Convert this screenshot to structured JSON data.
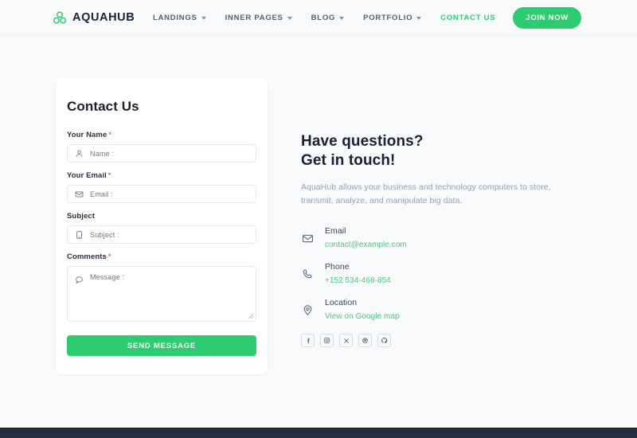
{
  "header": {
    "brand": {
      "name": "AQUAHUB",
      "icon": "three-circles-logo-icon"
    },
    "nav": [
      {
        "label": "LANDINGS",
        "has_caret": true,
        "active": false
      },
      {
        "label": "INNER PAGES",
        "has_caret": true,
        "active": false
      },
      {
        "label": "BLOG",
        "has_caret": true,
        "active": false
      },
      {
        "label": "PORTFOLIO",
        "has_caret": true,
        "active": false
      },
      {
        "label": "CONTACT US",
        "has_caret": false,
        "active": true
      }
    ],
    "cta": {
      "label": "JOIN NOW"
    }
  },
  "form": {
    "title": "Contact Us",
    "fields": [
      {
        "label": "Your Name",
        "required": true,
        "placeholder": "Name :",
        "icon": "user-icon"
      },
      {
        "label": "Your Email",
        "required": true,
        "placeholder": "Email :",
        "icon": "envelope-icon"
      },
      {
        "label": "Subject",
        "required": false,
        "placeholder": "Subject :",
        "icon": "note-icon"
      },
      {
        "label": "Comments",
        "required": true,
        "placeholder": "Message :",
        "icon": "chat-bubble-icon"
      }
    ],
    "required_marker": "*",
    "submit_label": "SEND MESSAGE"
  },
  "right": {
    "heading_line1": "Have questions?",
    "heading_line2": "Get in touch!",
    "description": "AquaHub allows your business and technology computers to store, transmit, analyze, and manipulate big data.",
    "contacts": [
      {
        "icon": "envelope-icon",
        "label": "Email",
        "value": "contact@example.com"
      },
      {
        "icon": "phone-icon",
        "label": "Phone",
        "value": "+152 534-468-854"
      },
      {
        "icon": "location-pin-icon",
        "label": "Location",
        "value": "View on Google map"
      }
    ],
    "socials": [
      {
        "name": "facebook-icon",
        "glyph": "f"
      },
      {
        "name": "instagram-icon",
        "glyph": ""
      },
      {
        "name": "x-twitter-icon",
        "glyph": "X"
      },
      {
        "name": "dribbble-icon",
        "glyph": ""
      },
      {
        "name": "github-icon",
        "glyph": ""
      }
    ]
  },
  "colors": {
    "accent_green": "#2ecc71",
    "link_green": "#4dc97e",
    "required_red": "#ff5a5f",
    "dark_navy": "#262b42",
    "page_bg": "#f8f9fb",
    "text_dark": "#1d2033",
    "text_muted": "#98a0b3"
  }
}
